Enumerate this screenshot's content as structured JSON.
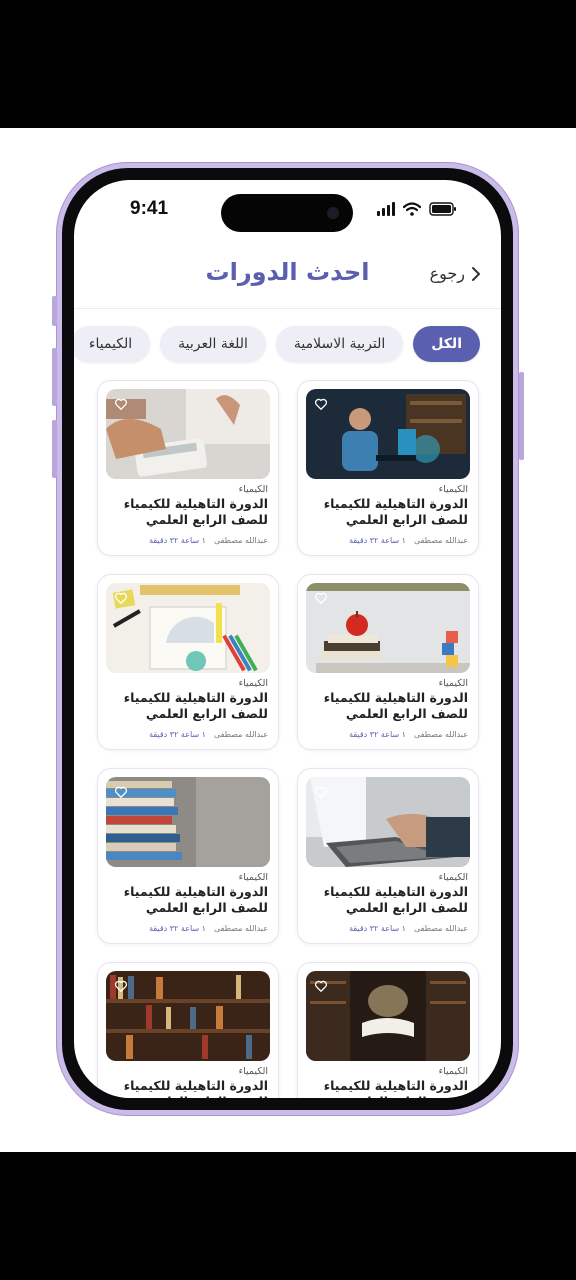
{
  "status": {
    "time": "9:41"
  },
  "header": {
    "title": "احدث الدورات",
    "back_label": "رجوع"
  },
  "categories": [
    "الكل",
    "التربية الاسلامية",
    "اللغة العربية",
    "الكيمياء"
  ],
  "active_category": "الكل",
  "courses": [
    {
      "image": "scientist-computer",
      "category": "الكيمياء",
      "title": "الدورة التاهيلية للكيمياء للصف الرابع العلمي",
      "author": "عبدالله مصطفى",
      "duration": "١ ساعة ٣٢ دقيقة"
    },
    {
      "image": "calculator-desk",
      "category": "الكيمياء",
      "title": "الدورة التاهيلية للكيمياء للصف الرابع العلمي",
      "author": "عبدالله مصطفى",
      "duration": "١ ساعة ٣٢ دقيقة"
    },
    {
      "image": "apple-books",
      "category": "الكيمياء",
      "title": "الدورة التاهيلية للكيمياء للصف الرابع العلمي",
      "author": "عبدالله مصطفى",
      "duration": "١ ساعة ٣٢ دقيقة"
    },
    {
      "image": "school-supplies",
      "category": "الكيمياء",
      "title": "الدورة التاهيلية للكيمياء للصف الرابع العلمي",
      "author": "عبدالله مصطفى",
      "duration": "١ ساعة ٣٢ دقيقة"
    },
    {
      "image": "laptop-typing",
      "category": "الكيمياء",
      "title": "الدورة التاهيلية للكيمياء للصف الرابع العلمي",
      "author": "عبدالله مصطفى",
      "duration": "١ ساعة ٣٢ دقيقة"
    },
    {
      "image": "book-stack",
      "category": "الكيمياء",
      "title": "الدورة التاهيلية للكيمياء للصف الرابع العلمي",
      "author": "عبدالله مصطفى",
      "duration": "١ ساعة ٣٢ دقيقة"
    },
    {
      "image": "library-open-book",
      "category": "الكيمياء",
      "title": "الدورة التاهيلية للكيمياء للصف الرابع العلمي",
      "author": "",
      "duration": ""
    },
    {
      "image": "bookshelf",
      "category": "الكيمياء",
      "title": "الدورة التاهيلية للكيمياء للصف الرابع العلمي",
      "author": "",
      "duration": ""
    }
  ],
  "colors": {
    "accent": "#5a5fb0",
    "chip_bg": "#eeeef6",
    "frame": "#cbbbe8"
  }
}
